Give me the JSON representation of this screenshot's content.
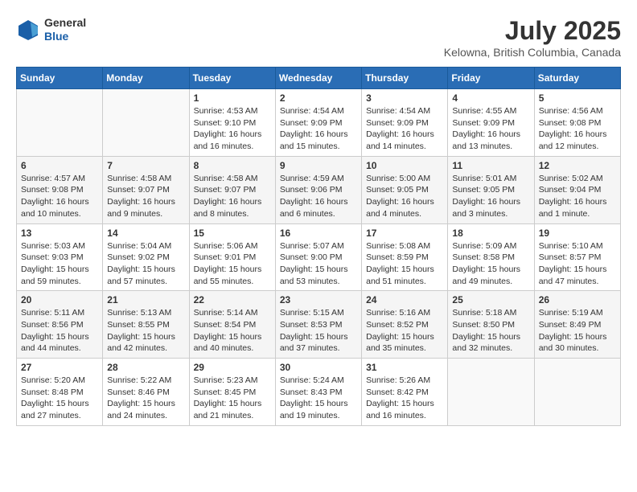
{
  "header": {
    "logo": {
      "general": "General",
      "blue": "Blue"
    },
    "title": "July 2025",
    "location": "Kelowna, British Columbia, Canada"
  },
  "days_header": [
    "Sunday",
    "Monday",
    "Tuesday",
    "Wednesday",
    "Thursday",
    "Friday",
    "Saturday"
  ],
  "weeks": [
    [
      {
        "day": "",
        "info": ""
      },
      {
        "day": "",
        "info": ""
      },
      {
        "day": "1",
        "info": "Sunrise: 4:53 AM\nSunset: 9:10 PM\nDaylight: 16 hours\nand 16 minutes."
      },
      {
        "day": "2",
        "info": "Sunrise: 4:54 AM\nSunset: 9:09 PM\nDaylight: 16 hours\nand 15 minutes."
      },
      {
        "day": "3",
        "info": "Sunrise: 4:54 AM\nSunset: 9:09 PM\nDaylight: 16 hours\nand 14 minutes."
      },
      {
        "day": "4",
        "info": "Sunrise: 4:55 AM\nSunset: 9:09 PM\nDaylight: 16 hours\nand 13 minutes."
      },
      {
        "day": "5",
        "info": "Sunrise: 4:56 AM\nSunset: 9:08 PM\nDaylight: 16 hours\nand 12 minutes."
      }
    ],
    [
      {
        "day": "6",
        "info": "Sunrise: 4:57 AM\nSunset: 9:08 PM\nDaylight: 16 hours\nand 10 minutes."
      },
      {
        "day": "7",
        "info": "Sunrise: 4:58 AM\nSunset: 9:07 PM\nDaylight: 16 hours\nand 9 minutes."
      },
      {
        "day": "8",
        "info": "Sunrise: 4:58 AM\nSunset: 9:07 PM\nDaylight: 16 hours\nand 8 minutes."
      },
      {
        "day": "9",
        "info": "Sunrise: 4:59 AM\nSunset: 9:06 PM\nDaylight: 16 hours\nand 6 minutes."
      },
      {
        "day": "10",
        "info": "Sunrise: 5:00 AM\nSunset: 9:05 PM\nDaylight: 16 hours\nand 4 minutes."
      },
      {
        "day": "11",
        "info": "Sunrise: 5:01 AM\nSunset: 9:05 PM\nDaylight: 16 hours\nand 3 minutes."
      },
      {
        "day": "12",
        "info": "Sunrise: 5:02 AM\nSunset: 9:04 PM\nDaylight: 16 hours\nand 1 minute."
      }
    ],
    [
      {
        "day": "13",
        "info": "Sunrise: 5:03 AM\nSunset: 9:03 PM\nDaylight: 15 hours\nand 59 minutes."
      },
      {
        "day": "14",
        "info": "Sunrise: 5:04 AM\nSunset: 9:02 PM\nDaylight: 15 hours\nand 57 minutes."
      },
      {
        "day": "15",
        "info": "Sunrise: 5:06 AM\nSunset: 9:01 PM\nDaylight: 15 hours\nand 55 minutes."
      },
      {
        "day": "16",
        "info": "Sunrise: 5:07 AM\nSunset: 9:00 PM\nDaylight: 15 hours\nand 53 minutes."
      },
      {
        "day": "17",
        "info": "Sunrise: 5:08 AM\nSunset: 8:59 PM\nDaylight: 15 hours\nand 51 minutes."
      },
      {
        "day": "18",
        "info": "Sunrise: 5:09 AM\nSunset: 8:58 PM\nDaylight: 15 hours\nand 49 minutes."
      },
      {
        "day": "19",
        "info": "Sunrise: 5:10 AM\nSunset: 8:57 PM\nDaylight: 15 hours\nand 47 minutes."
      }
    ],
    [
      {
        "day": "20",
        "info": "Sunrise: 5:11 AM\nSunset: 8:56 PM\nDaylight: 15 hours\nand 44 minutes."
      },
      {
        "day": "21",
        "info": "Sunrise: 5:13 AM\nSunset: 8:55 PM\nDaylight: 15 hours\nand 42 minutes."
      },
      {
        "day": "22",
        "info": "Sunrise: 5:14 AM\nSunset: 8:54 PM\nDaylight: 15 hours\nand 40 minutes."
      },
      {
        "day": "23",
        "info": "Sunrise: 5:15 AM\nSunset: 8:53 PM\nDaylight: 15 hours\nand 37 minutes."
      },
      {
        "day": "24",
        "info": "Sunrise: 5:16 AM\nSunset: 8:52 PM\nDaylight: 15 hours\nand 35 minutes."
      },
      {
        "day": "25",
        "info": "Sunrise: 5:18 AM\nSunset: 8:50 PM\nDaylight: 15 hours\nand 32 minutes."
      },
      {
        "day": "26",
        "info": "Sunrise: 5:19 AM\nSunset: 8:49 PM\nDaylight: 15 hours\nand 30 minutes."
      }
    ],
    [
      {
        "day": "27",
        "info": "Sunrise: 5:20 AM\nSunset: 8:48 PM\nDaylight: 15 hours\nand 27 minutes."
      },
      {
        "day": "28",
        "info": "Sunrise: 5:22 AM\nSunset: 8:46 PM\nDaylight: 15 hours\nand 24 minutes."
      },
      {
        "day": "29",
        "info": "Sunrise: 5:23 AM\nSunset: 8:45 PM\nDaylight: 15 hours\nand 21 minutes."
      },
      {
        "day": "30",
        "info": "Sunrise: 5:24 AM\nSunset: 8:43 PM\nDaylight: 15 hours\nand 19 minutes."
      },
      {
        "day": "31",
        "info": "Sunrise: 5:26 AM\nSunset: 8:42 PM\nDaylight: 15 hours\nand 16 minutes."
      },
      {
        "day": "",
        "info": ""
      },
      {
        "day": "",
        "info": ""
      }
    ]
  ]
}
